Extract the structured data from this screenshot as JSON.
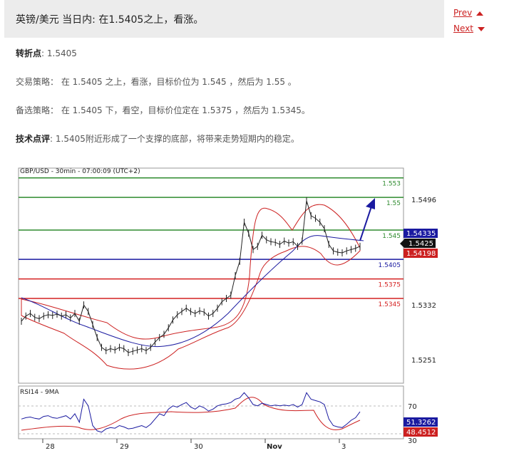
{
  "header": {
    "title": "英镑/美元 当日内: 在1.5405之上，看涨。",
    "prev_label": "Prev",
    "next_label": "Next"
  },
  "pivot": {
    "label": "转折点",
    "value": ": 1.5405"
  },
  "strategy": {
    "label": "交易策略",
    "text": "： 在 1.5405 之上，看涨，目标价位为 1.545 ，然后为 1.55 。"
  },
  "alternative": {
    "label": "备选策略",
    "text": "： 在 1.5405 下，看空，目标价位定在 1.5375 ，然后为 1.5345。"
  },
  "comment": {
    "label": "技术点评",
    "text": ": 1.5405附近形成了一个支撑的底部，将带来走势短期内的稳定。"
  },
  "chart": {
    "title": "GBP/USD - 30min - 07:00:09 (UTC+2)",
    "rsi_title": "RSI14 - 9MA",
    "level_labels": [
      "1.553",
      "1.55",
      "1.545",
      "1.5405",
      "1.5375",
      "1.5345"
    ],
    "price_ticks": [
      "1.5496",
      "1.5332",
      "1.5251"
    ],
    "current_price": "1.5425",
    "ma_price": "1.54335",
    "ma2_price": "1.54198",
    "rsi_ticks": [
      "70",
      "30"
    ],
    "rsi_value": "51.3262",
    "rsi_ma_value": "48.4512",
    "x_ticks": [
      "28",
      "29",
      "30",
      "Nov",
      "3"
    ],
    "colors": {
      "green": "#2e8b2e",
      "blue": "#1a1aa0",
      "red": "#d42020",
      "accent": "#cc2222"
    }
  },
  "chart_data": {
    "type": "line",
    "title": "GBP/USD - 30min - 07:00:09 (UTC+2)",
    "x": [
      "28",
      "29",
      "30",
      "Nov",
      "3"
    ],
    "ylim": [
      1.5215,
      1.5545
    ],
    "levels": [
      {
        "value": 1.553,
        "color": "green"
      },
      {
        "value": 1.55,
        "color": "green"
      },
      {
        "value": 1.545,
        "color": "green"
      },
      {
        "value": 1.5405,
        "color": "blue"
      },
      {
        "value": 1.5375,
        "color": "red"
      },
      {
        "value": 1.5345,
        "color": "red"
      }
    ],
    "series": [
      {
        "values": [
          1.531,
          1.5318,
          1.5322,
          1.5316,
          1.5314,
          1.5318,
          1.532,
          1.5319,
          1.5321,
          1.5318,
          1.532,
          1.5315,
          1.5322,
          1.531,
          1.5335,
          1.5325,
          1.5305,
          1.5285,
          1.527,
          1.5265,
          1.5268,
          1.5266,
          1.527,
          1.5268,
          1.5262,
          1.5264,
          1.5266,
          1.5268,
          1.5265,
          1.527,
          1.5278,
          1.5285,
          1.529,
          1.53,
          1.5312,
          1.532,
          1.5325,
          1.533,
          1.5325,
          1.5322,
          1.5326,
          1.5324,
          1.5318,
          1.5322,
          1.533,
          1.534,
          1.5345,
          1.535,
          1.538,
          1.5402,
          1.5462,
          1.5445,
          1.542,
          1.5425,
          1.5442,
          1.5435,
          1.5432,
          1.5431,
          1.5428,
          1.5433,
          1.543,
          1.5432,
          1.5425,
          1.5433,
          1.5495,
          1.5472,
          1.5468,
          1.5462,
          1.5452,
          1.5428,
          1.5418,
          1.5416,
          1.5415,
          1.5418,
          1.542,
          1.5422,
          1.5425
        ]
      },
      {
        "name": "RSI14",
        "values": [
          40,
          42,
          43,
          41,
          40,
          44,
          45,
          42,
          41,
          43,
          45,
          40,
          48,
          35,
          70,
          60,
          30,
          22,
          20,
          25,
          27,
          26,
          30,
          28,
          25,
          26,
          28,
          30,
          27,
          32,
          40,
          48,
          45,
          55,
          60,
          58,
          62,
          65,
          58,
          55,
          60,
          57,
          52,
          55,
          60,
          62,
          63,
          65,
          70,
          72,
          80,
          72,
          62,
          60,
          64,
          62,
          60,
          61,
          60,
          61,
          60,
          62,
          58,
          62,
          80,
          70,
          68,
          66,
          62,
          40,
          30,
          28,
          27,
          32,
          38,
          42,
          51
        ]
      }
    ]
  }
}
